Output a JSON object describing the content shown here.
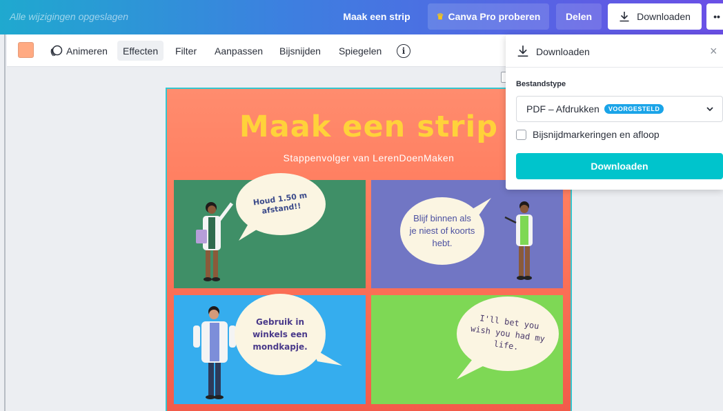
{
  "topbar": {
    "saved_status": "Alle wijzigingen opgeslagen",
    "title_button": "Maak een strip",
    "pro_button": "Canva Pro proberen",
    "share_button": "Delen",
    "download_button": "Downloaden",
    "more_button": "••"
  },
  "toolbar": {
    "color_swatch": "#ffaa82",
    "animate": "Animeren",
    "effects": "Effecten",
    "filter": "Filter",
    "adjust": "Aanpassen",
    "crop": "Bijsnijden",
    "flip": "Spiegelen",
    "info": "i"
  },
  "design": {
    "title": "Maak een strip",
    "subtitle": "Stappenvolger van LerenDoenMaken",
    "panels": [
      {
        "text": "Houd 1.50 m afstand!!",
        "color": "#3f8f67"
      },
      {
        "text": "Blijf binnen als je niest of koorts hebt.",
        "color": "#7176c4"
      },
      {
        "text": "Gebruik in winkels een mondkapje.",
        "color": "#35adee"
      },
      {
        "text": "I'll bet you wish you had my life.",
        "color": "#7ed855"
      }
    ]
  },
  "download_panel": {
    "title": "Downloaden",
    "close": "×",
    "file_type_label": "Bestandstype",
    "file_type_value": "PDF – Afdrukken",
    "badge": "VOORGESTELD",
    "crop_marks_label": "Bijsnijdmarkeringen en afloop",
    "crop_marks_checked": false,
    "download_button": "Downloaden",
    "accent": "#00c4cc"
  }
}
